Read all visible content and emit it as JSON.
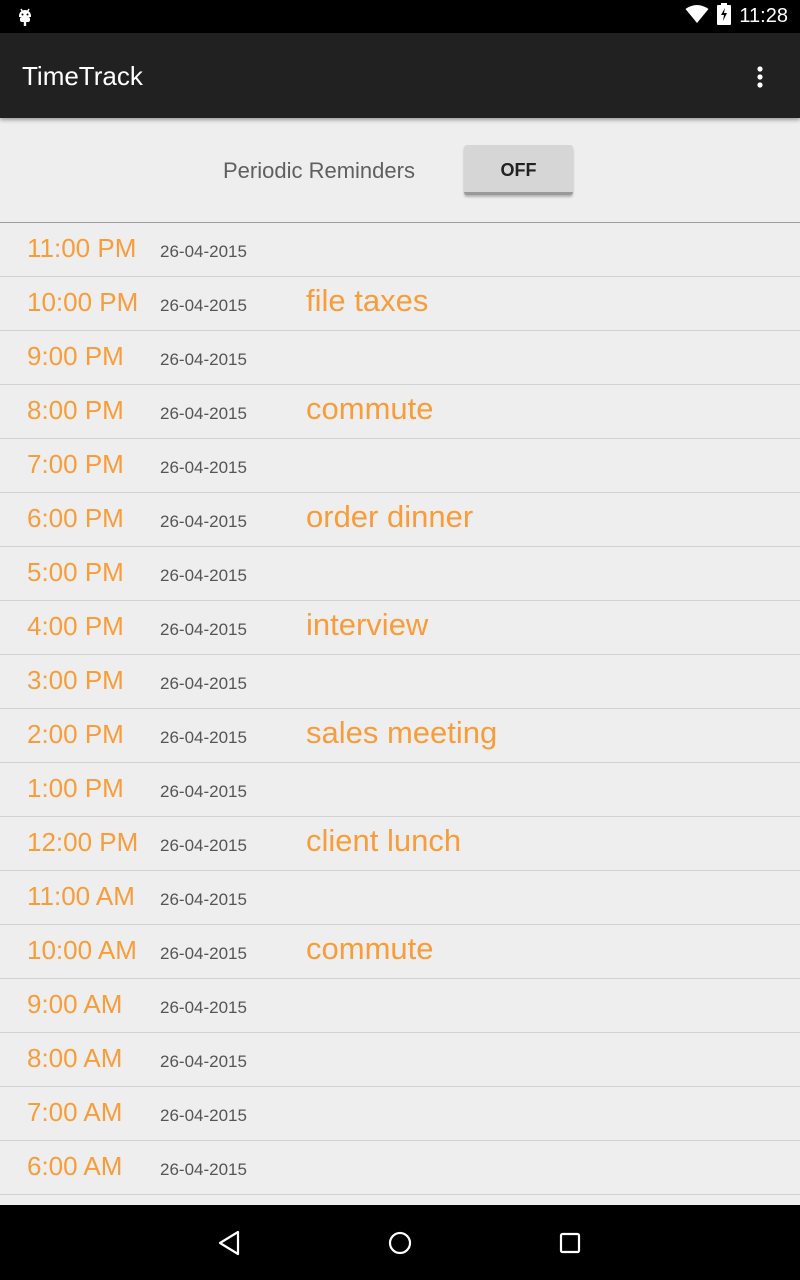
{
  "status_bar": {
    "time": "11:28",
    "icons": [
      "android-notification-icon",
      "wifi-icon",
      "battery-charging-icon"
    ]
  },
  "app_bar": {
    "title": "TimeTrack",
    "menu_icon": "more-vert-icon"
  },
  "reminders": {
    "label": "Periodic Reminders",
    "toggle_label": "OFF"
  },
  "colors": {
    "accent": "#f89d3a",
    "app_bar": "#212121",
    "background": "#eeeeee"
  },
  "entries": [
    {
      "time": "11:00 PM",
      "date": "26-04-2015",
      "note": ""
    },
    {
      "time": "10:00 PM",
      "date": "26-04-2015",
      "note": "file taxes"
    },
    {
      "time": "9:00 PM",
      "date": "26-04-2015",
      "note": ""
    },
    {
      "time": "8:00 PM",
      "date": "26-04-2015",
      "note": "commute"
    },
    {
      "time": "7:00 PM",
      "date": "26-04-2015",
      "note": ""
    },
    {
      "time": "6:00 PM",
      "date": "26-04-2015",
      "note": "order dinner"
    },
    {
      "time": "5:00 PM",
      "date": "26-04-2015",
      "note": ""
    },
    {
      "time": "4:00 PM",
      "date": "26-04-2015",
      "note": "interview"
    },
    {
      "time": "3:00 PM",
      "date": "26-04-2015",
      "note": ""
    },
    {
      "time": "2:00 PM",
      "date": "26-04-2015",
      "note": "sales meeting"
    },
    {
      "time": "1:00 PM",
      "date": "26-04-2015",
      "note": ""
    },
    {
      "time": "12:00 PM",
      "date": "26-04-2015",
      "note": "client lunch"
    },
    {
      "time": "11:00 AM",
      "date": "26-04-2015",
      "note": ""
    },
    {
      "time": "10:00 AM",
      "date": "26-04-2015",
      "note": "commute"
    },
    {
      "time": "9:00 AM",
      "date": "26-04-2015",
      "note": ""
    },
    {
      "time": "8:00 AM",
      "date": "26-04-2015",
      "note": ""
    },
    {
      "time": "7:00 AM",
      "date": "26-04-2015",
      "note": ""
    },
    {
      "time": "6:00 AM",
      "date": "26-04-2015",
      "note": ""
    }
  ],
  "nav_bar": {
    "buttons": [
      "back-icon",
      "home-icon",
      "recents-icon"
    ]
  }
}
